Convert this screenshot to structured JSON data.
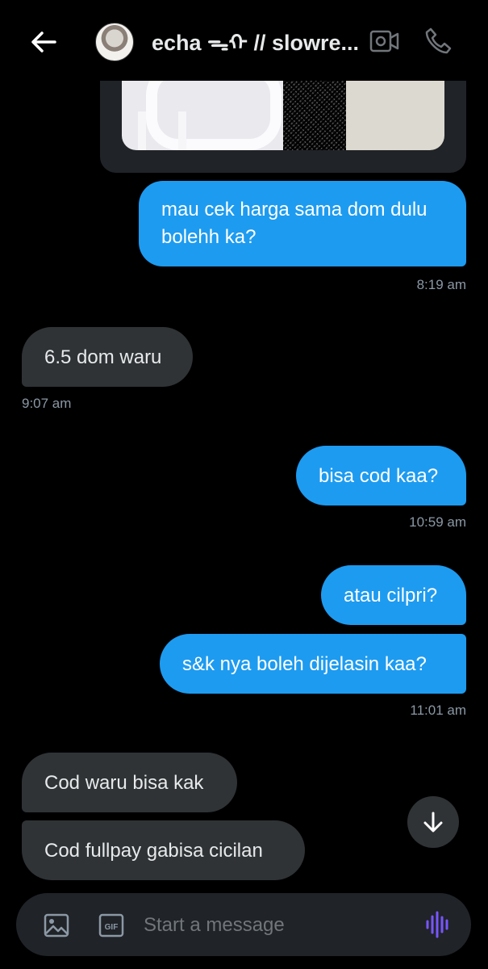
{
  "header": {
    "title": "echa ᯓᡣ // slowre...",
    "back_icon": "arrow-left-icon",
    "video_icon": "video-call-icon",
    "call_icon": "phone-icon"
  },
  "messages": [
    {
      "text": "mau cek harga sama dom dulu\nbolehh ka?",
      "direction": "out",
      "time": "8:19 am"
    },
    {
      "text": "6.5 dom waru",
      "direction": "in",
      "time": "9:07 am"
    },
    {
      "text": "bisa cod kaa?",
      "direction": "out",
      "time": "10:59 am"
    },
    {
      "text": "atau cilpri?",
      "direction": "out"
    },
    {
      "text": "s&k nya boleh dijelasin kaa?",
      "direction": "out",
      "time": "11:01 am"
    },
    {
      "text": "Cod waru bisa kak",
      "direction": "in"
    },
    {
      "text": "Cod fullpay gabisa cicilan",
      "direction": "in"
    }
  ],
  "composer": {
    "placeholder": "Start a message",
    "gif_label": "GIF",
    "image_icon": "image-icon",
    "voice_icon": "voice-wave-icon"
  },
  "scroll_icon": "arrow-down-icon",
  "colors": {
    "background": "#000000",
    "outgoing_bubble": "#1d9bf0",
    "incoming_bubble": "#2f3336",
    "timestamp": "#8b98a5",
    "voice_accent": "#7856ff"
  }
}
